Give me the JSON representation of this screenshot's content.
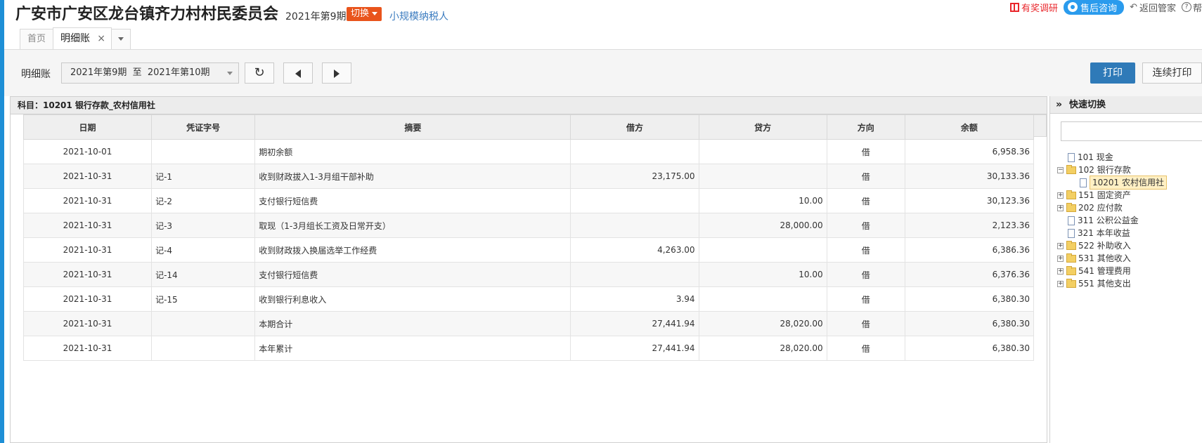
{
  "header": {
    "org_title": "广安市广安区龙台镇齐力村村民委员会",
    "period": "2021年第9期",
    "switch_label": "切换",
    "taxpayer": "小规模纳税人",
    "survey": "有奖调研",
    "consult": "售后咨询",
    "back": "返回管家",
    "help": "帮"
  },
  "tabs": [
    {
      "label": "首页"
    },
    {
      "label": "明细账",
      "close": "×"
    }
  ],
  "toolbar": {
    "label": "明细账",
    "period_range": "2021年第9期  至  2021年第10期",
    "refresh_glyph": "↻",
    "print": "打印",
    "continuous_print": "连续打印"
  },
  "subject": "科目：10201  银行存款_农村信用社",
  "table": {
    "columns": [
      "日期",
      "凭证字号",
      "摘要",
      "借方",
      "贷方",
      "方向",
      "余额"
    ],
    "rows": [
      {
        "date": "2021-10-01",
        "voucher": "",
        "summary": "期初余额",
        "debit": "",
        "credit": "",
        "dir": "借",
        "balance": "6,958.36",
        "indent": true
      },
      {
        "date": "2021-10-31",
        "voucher": "记-1",
        "summary": "收到财政拔入1-3月组干部补助",
        "debit": "23,175.00",
        "credit": "",
        "dir": "借",
        "balance": "30,133.36",
        "indent": false
      },
      {
        "date": "2021-10-31",
        "voucher": "记-2",
        "summary": "支付银行短信费",
        "debit": "",
        "credit": "10.00",
        "dir": "借",
        "balance": "30,123.36",
        "indent": false
      },
      {
        "date": "2021-10-31",
        "voucher": "记-3",
        "summary": "取现（1-3月组长工资及日常开支）",
        "debit": "",
        "credit": "28,000.00",
        "dir": "借",
        "balance": "2,123.36",
        "indent": false
      },
      {
        "date": "2021-10-31",
        "voucher": "记-4",
        "summary": "收到财政拨入换届选举工作经费",
        "debit": "4,263.00",
        "credit": "",
        "dir": "借",
        "balance": "6,386.36",
        "indent": false
      },
      {
        "date": "2021-10-31",
        "voucher": "记-14",
        "summary": "支付银行短信费",
        "debit": "",
        "credit": "10.00",
        "dir": "借",
        "balance": "6,376.36",
        "indent": false
      },
      {
        "date": "2021-10-31",
        "voucher": "记-15",
        "summary": "收到银行利息收入",
        "debit": "3.94",
        "credit": "",
        "dir": "借",
        "balance": "6,380.30",
        "indent": false
      },
      {
        "date": "2021-10-31",
        "voucher": "",
        "summary": "本期合计",
        "debit": "27,441.94",
        "credit": "28,020.00",
        "dir": "借",
        "balance": "6,380.30",
        "indent": true
      },
      {
        "date": "2021-10-31",
        "voucher": "",
        "summary": "本年累计",
        "debit": "27,441.94",
        "credit": "28,020.00",
        "dir": "借",
        "balance": "6,380.30",
        "indent": true
      }
    ]
  },
  "side": {
    "title": "快速切换",
    "collapse_glyph": "»",
    "tree": [
      {
        "label": "101 现金",
        "type": "doc",
        "expander": ""
      },
      {
        "label": "102 银行存款",
        "type": "folder",
        "expander": "−"
      },
      {
        "label": "10201 农村信用社",
        "type": "doc",
        "expander": "",
        "child": true,
        "selected": true
      },
      {
        "label": "151 固定资产",
        "type": "folder",
        "expander": "+"
      },
      {
        "label": "202 应付款",
        "type": "folder",
        "expander": "+"
      },
      {
        "label": "311 公积公益金",
        "type": "doc",
        "expander": ""
      },
      {
        "label": "321 本年收益",
        "type": "doc",
        "expander": ""
      },
      {
        "label": "522 补助收入",
        "type": "folder",
        "expander": "+"
      },
      {
        "label": "531 其他收入",
        "type": "folder",
        "expander": "+"
      },
      {
        "label": "541 管理费用",
        "type": "folder",
        "expander": "+"
      },
      {
        "label": "551 其他支出",
        "type": "folder",
        "expander": "+"
      }
    ]
  }
}
